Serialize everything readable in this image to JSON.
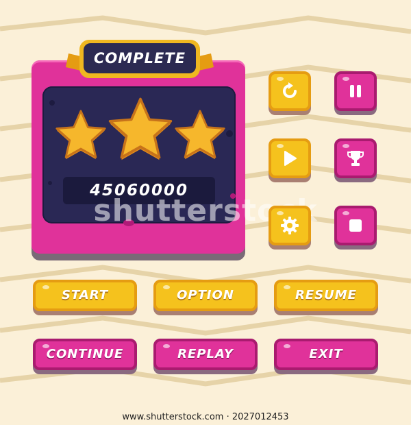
{
  "colors": {
    "background": "#fbf0d8",
    "zigzag": "#e6d3a8",
    "pink": "#e0329a",
    "yellow": "#f5c21d",
    "navy": "#2a2855",
    "star": "#f6b72c"
  },
  "dialog": {
    "title": "COMPLETE",
    "stars_earned": 3,
    "stars_total": 3,
    "score": "45060000"
  },
  "icon_buttons": [
    {
      "name": "replay-icon",
      "color": "yellow"
    },
    {
      "name": "pause-icon",
      "color": "pink"
    },
    {
      "name": "play-icon",
      "color": "yellow"
    },
    {
      "name": "trophy-icon",
      "color": "pink"
    },
    {
      "name": "gear-icon",
      "color": "yellow"
    },
    {
      "name": "stop-icon",
      "color": "pink"
    }
  ],
  "buttons": {
    "start": "START",
    "option": "OPTION",
    "resume": "RESUME",
    "continue": "CONTINUE",
    "replay": "REPLAY",
    "exit": "EXIT"
  },
  "watermark": {
    "overlay": "shutterstock",
    "caption": "www.shutterstock.com · 2027012453"
  }
}
